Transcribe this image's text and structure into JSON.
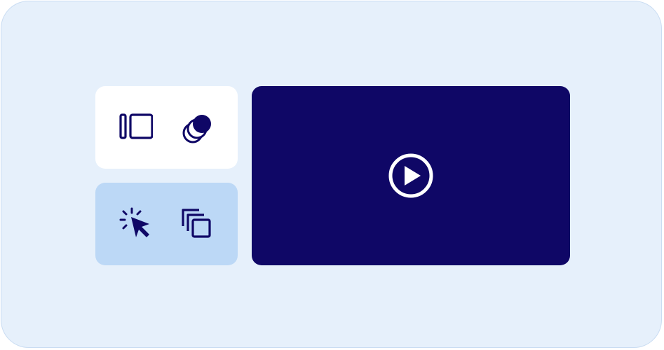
{
  "colors": {
    "frame_background": "#e6f0fb",
    "frame_border": "#c9dcf2",
    "card_top_background": "#ffffff",
    "card_bottom_background": "#bcd8f6",
    "icon_color": "#0f0766",
    "video_background": "#0f0766",
    "play_icon_color": "#ffffff"
  },
  "icons": {
    "top_card": [
      "sidebar-panel-icon",
      "stacked-circles-icon"
    ],
    "bottom_card": [
      "click-cursor-icon",
      "copy-layers-icon"
    ],
    "video": "play-circle-icon"
  }
}
